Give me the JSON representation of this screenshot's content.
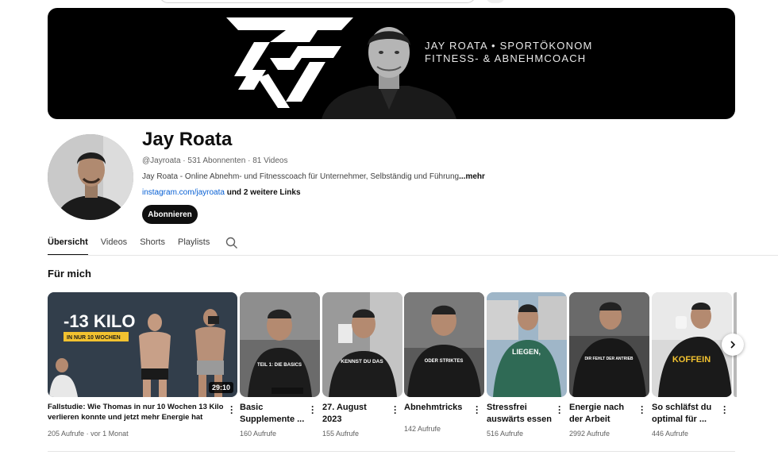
{
  "banner": {
    "tagline_1": "JAY ROATA • SPORTÖKONOM",
    "tagline_2": "FITNESS- & ABNEHMCOACH"
  },
  "channel": {
    "name": "Jay Roata",
    "handle": "@Jayroata",
    "subscribers": "531 Abonnenten",
    "videos": "81 Videos",
    "separator": "·",
    "description": "Jay Roata - Online Abnehm- und Fitnesscoach für Unternehmer, Selbständig und Führung",
    "more_label": "...mehr",
    "link": "instagram.com/jayroata",
    "extra_links": "und 2 weitere Links",
    "subscribe_label": "Abonnieren"
  },
  "tabs": [
    {
      "label": "Übersicht",
      "active": true
    },
    {
      "label": "Videos",
      "active": false
    },
    {
      "label": "Shorts",
      "active": false
    },
    {
      "label": "Playlists",
      "active": false
    }
  ],
  "section": {
    "title": "Für mich"
  },
  "videos": [
    {
      "title_line1": "Fallstudie: Wie Thomas in nur 10 Wochen 13 Kilo",
      "title_line2": "verlieren konnte und jetzt mehr Energie hat",
      "views": "205 Aufrufe",
      "age": "vor 1 Monat",
      "duration": "29:10",
      "thumb_headline": "-13 KILO",
      "thumb_sub": "IN NUR 10 WOCHEN"
    },
    {
      "title_line1": "Basic",
      "title_line2": "Supplemente ...",
      "views": "160 Aufrufe",
      "thumb_text": "TEIL 1: DIE BASICS"
    },
    {
      "title_line1": "27. August",
      "title_line2": "2023",
      "views": "155 Aufrufe",
      "thumb_text": "KENNST DU DAS"
    },
    {
      "title_line1": "Abnehmtricks",
      "title_line2": "",
      "views": "142 Aufrufe",
      "thumb_text": "ODER STRIKTES"
    },
    {
      "title_line1": "Stressfrei",
      "title_line2": "auswärts essen",
      "views": "516 Aufrufe",
      "thumb_text": "LIEGEN,"
    },
    {
      "title_line1": "Energie nach",
      "title_line2": "der Arbeit",
      "views": "2992 Aufrufe",
      "thumb_text": "DIR FEHLT DER ANTRIEB"
    },
    {
      "title_line1": "So schläfst du",
      "title_line2": "optimal für ...",
      "views": "446 Aufrufe",
      "thumb_text": "KOFFEIN"
    }
  ],
  "colors": {
    "accent_yellow": "#f2c230",
    "link_blue": "#065fd4",
    "text_primary": "#0f0f0f",
    "text_secondary": "#606060"
  }
}
